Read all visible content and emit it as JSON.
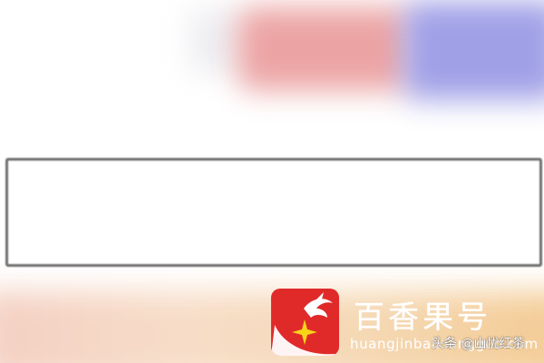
{
  "search": {
    "value": "",
    "placeholder": ""
  },
  "brand": {
    "name": "百香果号",
    "url": "huangjinbaixiangguo.com",
    "logo_icon": "passion-fruit-star-logo-icon",
    "logo_color": "#e02a2a",
    "star_color": "#f7d417"
  },
  "watermark": {
    "text": "头条 @山忧红茶"
  },
  "colors": {
    "blurred_red": "#ea9a9a",
    "blurred_blue": "#9b9be6",
    "blurred_bottom": "#f5d8b5",
    "input_border": "#6e6e6e"
  }
}
